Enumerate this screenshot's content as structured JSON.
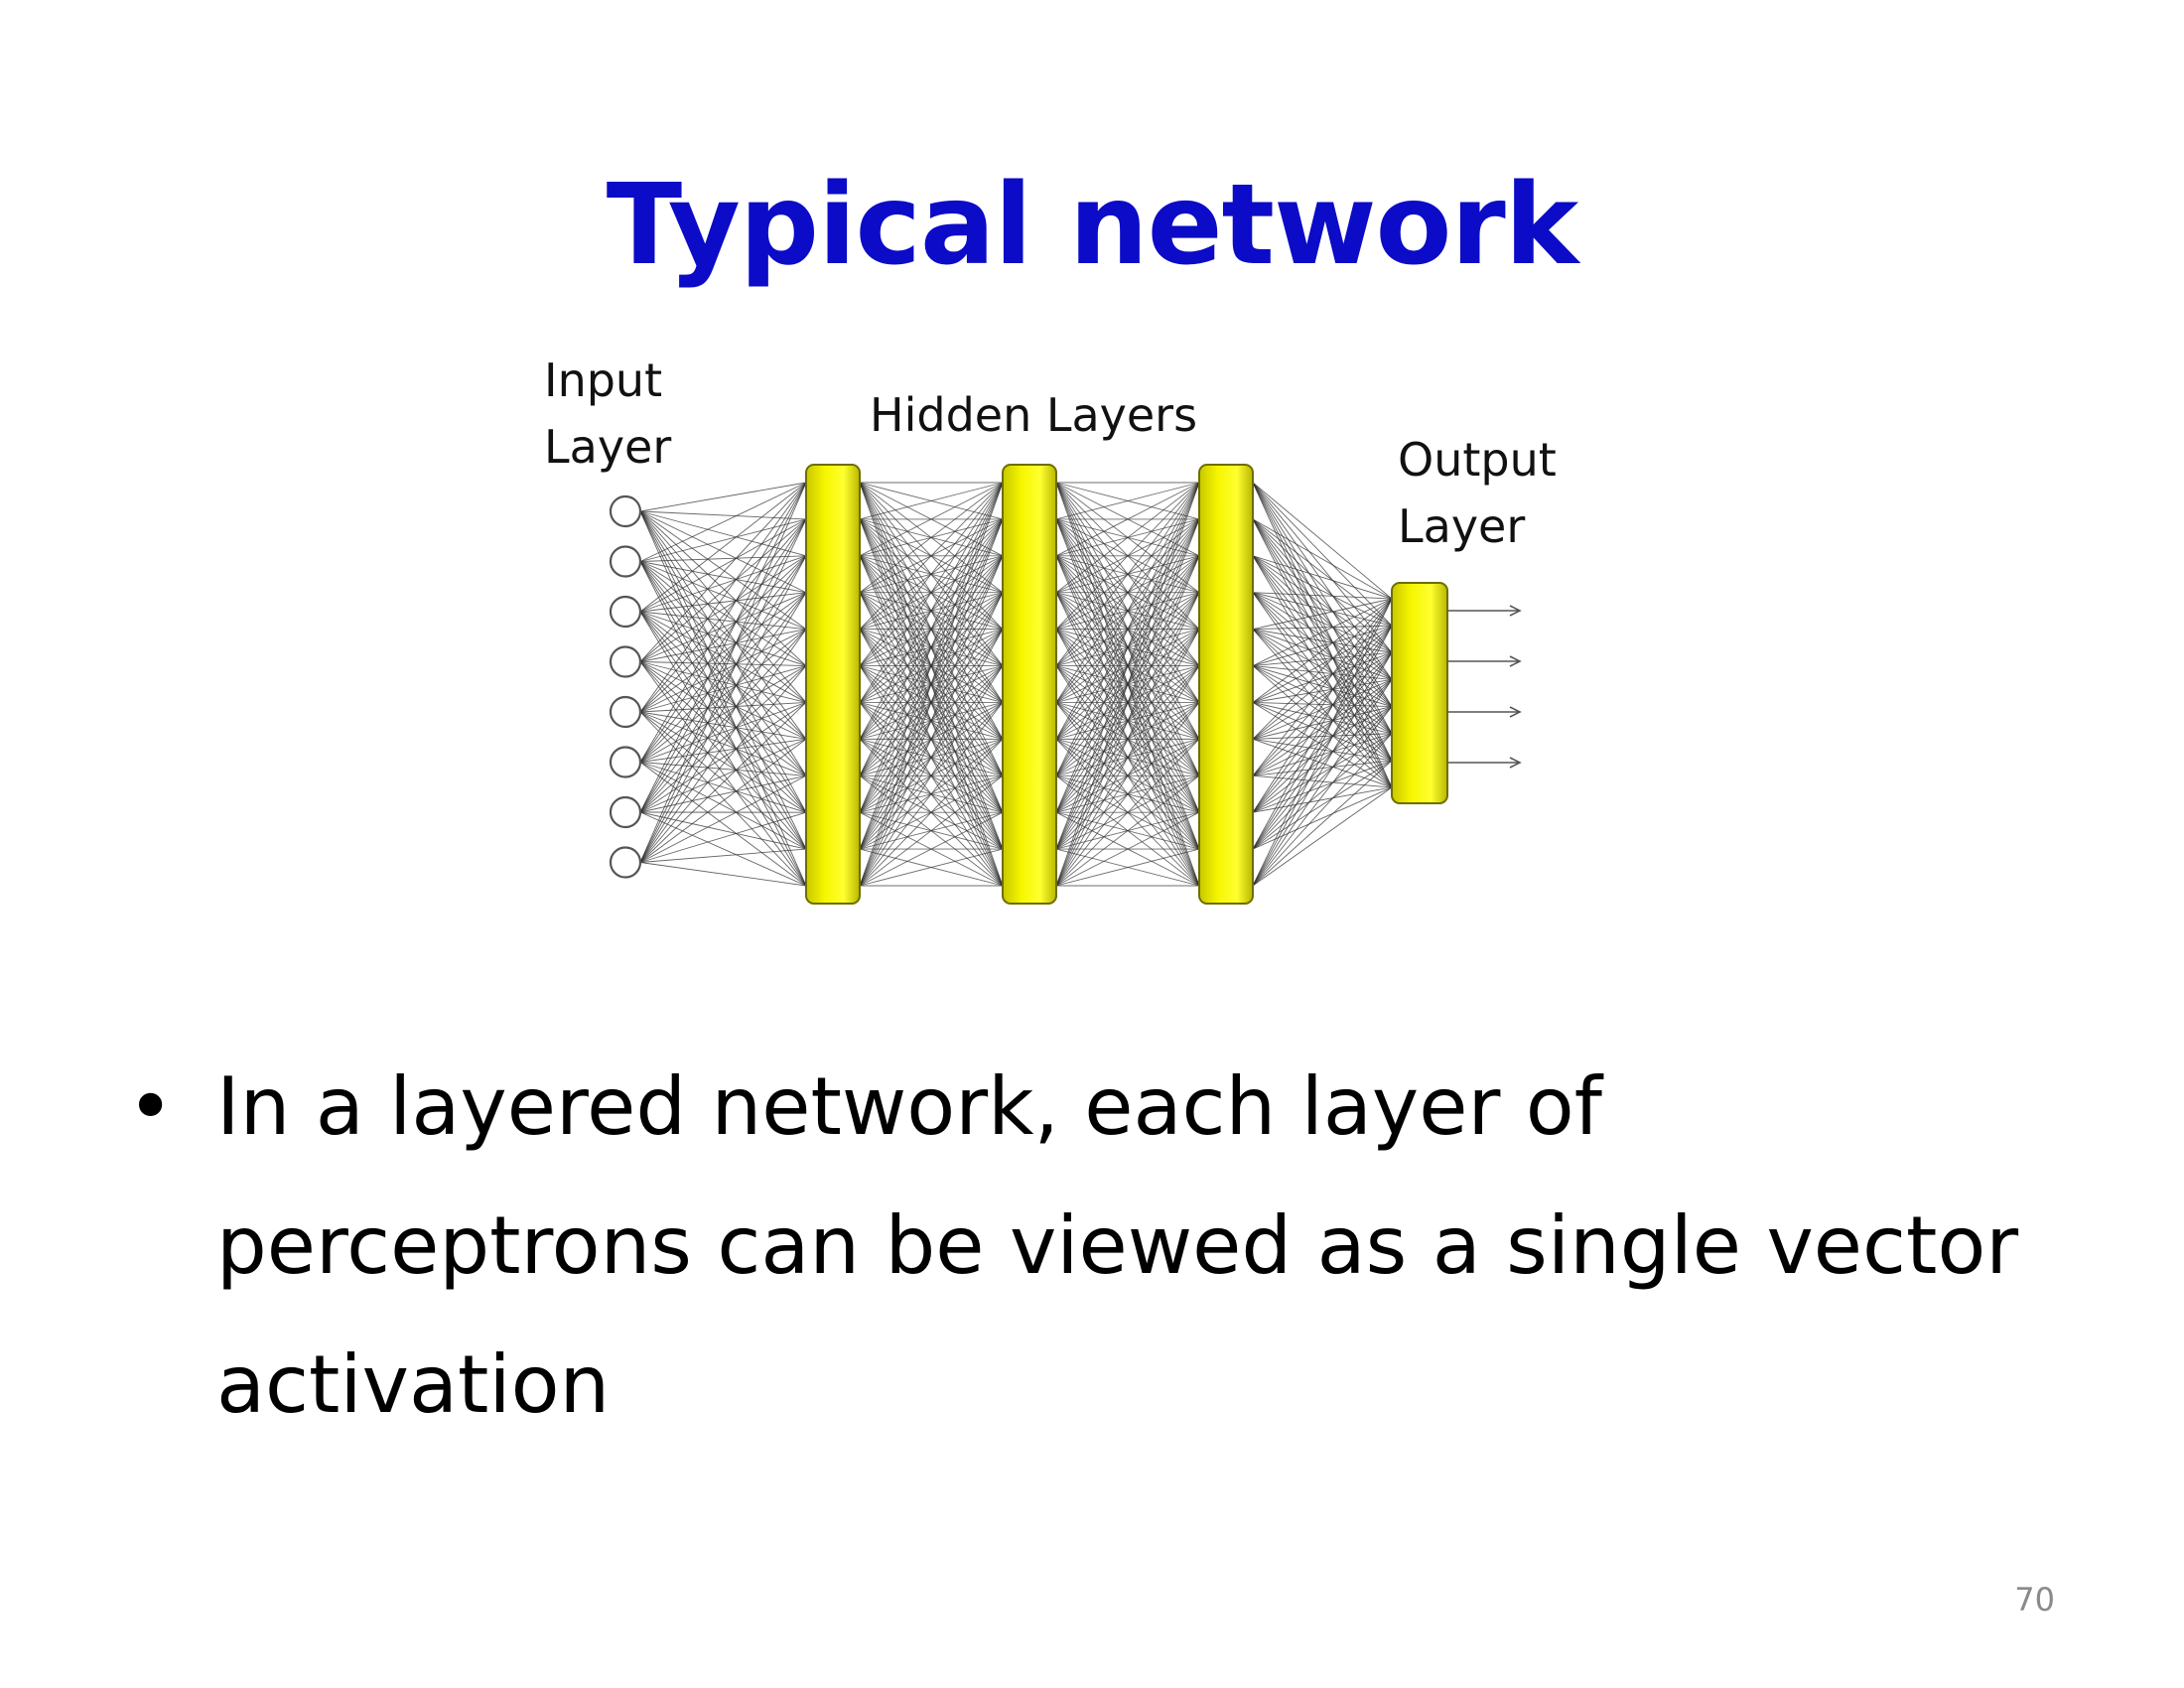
{
  "slide": {
    "title": "Typical network",
    "diagram": {
      "labels": {
        "input_line1": "Input",
        "input_line2": "Layer",
        "hidden": "Hidden Layers",
        "output_line1": "Output",
        "output_line2": "Layer"
      },
      "input_node_count": 8,
      "hidden_layer_count": 3,
      "output_count": 4,
      "colors": {
        "layer_fill": "#f2f200",
        "layer_border": "#6e6e00",
        "edge": "#303030",
        "node_border": "#555555"
      }
    },
    "bullet": "In a layered network, each layer of perceptrons can be viewed as a single vector activation",
    "page_number": "70"
  }
}
